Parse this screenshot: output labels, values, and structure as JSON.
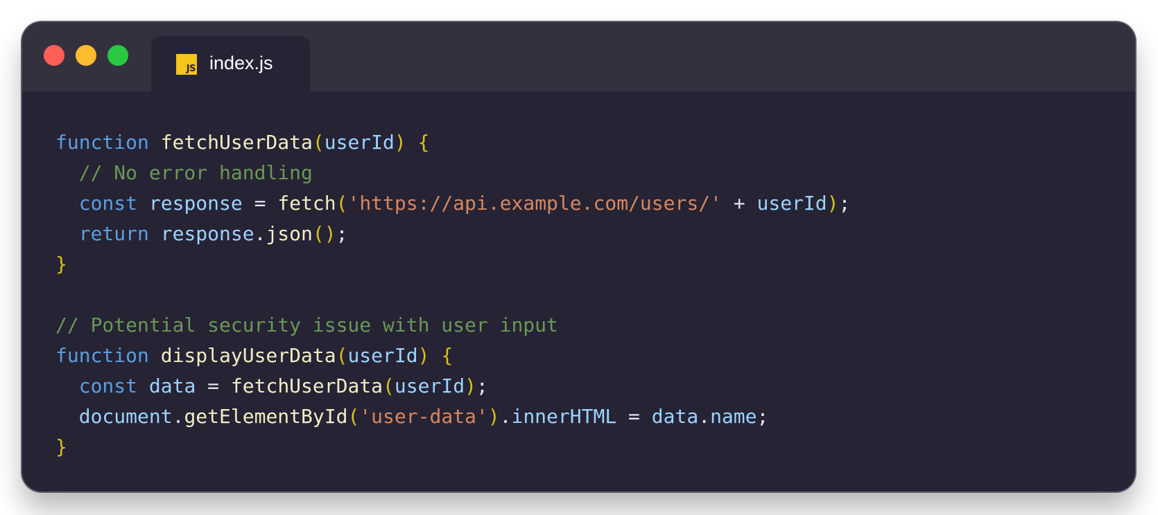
{
  "window": {
    "dots": [
      {
        "name": "close",
        "color": "#ff5f57"
      },
      {
        "name": "minimize",
        "color": "#febc2e"
      },
      {
        "name": "maximize",
        "color": "#28c840"
      }
    ],
    "tab": {
      "icon_text": "JS",
      "label": "index.js"
    }
  },
  "colors": {
    "keyword": "#5a9fe0",
    "function": "#f1eec4",
    "variable": "#9cd4ff",
    "bracket": "#d8c21a",
    "string": "#d7875f",
    "comment": "#6a9955",
    "punctuation": "#e6e6ee",
    "background": "#262335",
    "titlebar": "#34313f"
  },
  "code": {
    "lines": [
      [
        [
          "kw",
          "function"
        ],
        [
          "pn",
          " "
        ],
        [
          "fn",
          "fetchUserData"
        ],
        [
          "br",
          "("
        ],
        [
          "vr",
          "userId"
        ],
        [
          "br",
          ")"
        ],
        [
          "pn",
          " "
        ],
        [
          "br",
          "{"
        ]
      ],
      [
        [
          "pn",
          "  "
        ],
        [
          "cm",
          "// No error handling"
        ]
      ],
      [
        [
          "pn",
          "  "
        ],
        [
          "kw",
          "const"
        ],
        [
          "pn",
          " "
        ],
        [
          "vr",
          "response"
        ],
        [
          "pn",
          " = "
        ],
        [
          "fn",
          "fetch"
        ],
        [
          "br",
          "("
        ],
        [
          "str",
          "'https://api.example.com/users/'"
        ],
        [
          "pn",
          " + "
        ],
        [
          "vr",
          "userId"
        ],
        [
          "br",
          ")"
        ],
        [
          "pn",
          ";"
        ]
      ],
      [
        [
          "pn",
          "  "
        ],
        [
          "kw",
          "return"
        ],
        [
          "pn",
          " "
        ],
        [
          "vr",
          "response"
        ],
        [
          "pn",
          "."
        ],
        [
          "fn",
          "json"
        ],
        [
          "br",
          "()"
        ],
        [
          "pn",
          ";"
        ]
      ],
      [
        [
          "br",
          "}"
        ]
      ],
      [],
      [
        [
          "cm",
          "// Potential security issue with user input"
        ]
      ],
      [
        [
          "kw",
          "function"
        ],
        [
          "pn",
          " "
        ],
        [
          "fn",
          "displayUserData"
        ],
        [
          "br",
          "("
        ],
        [
          "vr",
          "userId"
        ],
        [
          "br",
          ")"
        ],
        [
          "pn",
          " "
        ],
        [
          "br",
          "{"
        ]
      ],
      [
        [
          "pn",
          "  "
        ],
        [
          "kw",
          "const"
        ],
        [
          "pn",
          " "
        ],
        [
          "vr",
          "data"
        ],
        [
          "pn",
          " = "
        ],
        [
          "fn",
          "fetchUserData"
        ],
        [
          "br",
          "("
        ],
        [
          "vr",
          "userId"
        ],
        [
          "br",
          ")"
        ],
        [
          "pn",
          ";"
        ]
      ],
      [
        [
          "pn",
          "  "
        ],
        [
          "vr",
          "document"
        ],
        [
          "pn",
          "."
        ],
        [
          "fn",
          "getElementById"
        ],
        [
          "br",
          "("
        ],
        [
          "str",
          "'user-data'"
        ],
        [
          "br",
          ")"
        ],
        [
          "pn",
          "."
        ],
        [
          "vr",
          "innerHTML"
        ],
        [
          "pn",
          " = "
        ],
        [
          "vr",
          "data"
        ],
        [
          "pn",
          "."
        ],
        [
          "vr",
          "name"
        ],
        [
          "pn",
          ";"
        ]
      ],
      [
        [
          "br",
          "}"
        ]
      ]
    ]
  }
}
